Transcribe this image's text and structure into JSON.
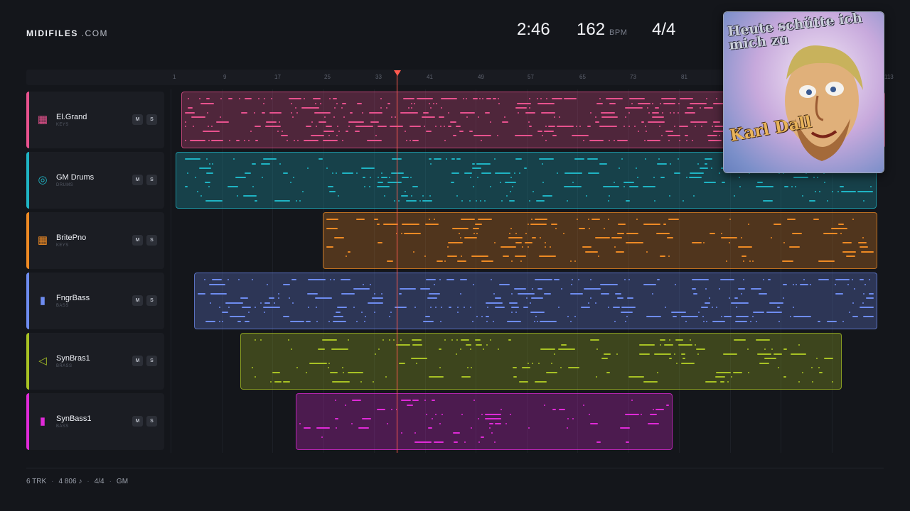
{
  "brand": {
    "name": "MIDIFILES",
    "domain": ".COM"
  },
  "transport": {
    "time": "2:46",
    "bpm": "162",
    "bpm_unit": "BPM",
    "signature": "4/4"
  },
  "ruler_ticks": [
    "1",
    "9",
    "17",
    "25",
    "33",
    "41",
    "49",
    "57",
    "65",
    "73",
    "81",
    "113"
  ],
  "playhead_bar": 35,
  "tracks": [
    {
      "name": "El.Grand",
      "category": "KEYS",
      "icon": "piano-icon",
      "color": "#e8528e",
      "mute": "M",
      "solo": "S"
    },
    {
      "name": "GM Drums",
      "category": "DRUMS",
      "icon": "drum-icon",
      "color": "#1fb4c4",
      "mute": "M",
      "solo": "S"
    },
    {
      "name": "BritePno",
      "category": "KEYS",
      "icon": "piano-icon",
      "color": "#ee8a24",
      "mute": "M",
      "solo": "S"
    },
    {
      "name": "FngrBass",
      "category": "BASS",
      "icon": "bass-icon",
      "color": "#6e8cf0",
      "mute": "M",
      "solo": "S"
    },
    {
      "name": "SynBras1",
      "category": "BRASS",
      "icon": "horn-icon",
      "color": "#a8c224",
      "mute": "M",
      "solo": "S"
    },
    {
      "name": "SynBass1",
      "category": "BASS",
      "icon": "bass-icon",
      "color": "#e02ad8",
      "mute": "M",
      "solo": "S"
    }
  ],
  "footer": {
    "tracks": "6 TRK",
    "notes": "4 806 ♪",
    "signature": "4/4",
    "standard": "GM"
  },
  "cover": {
    "title": "Heute schütte ich mich zu",
    "artist": "Karl Dall"
  }
}
